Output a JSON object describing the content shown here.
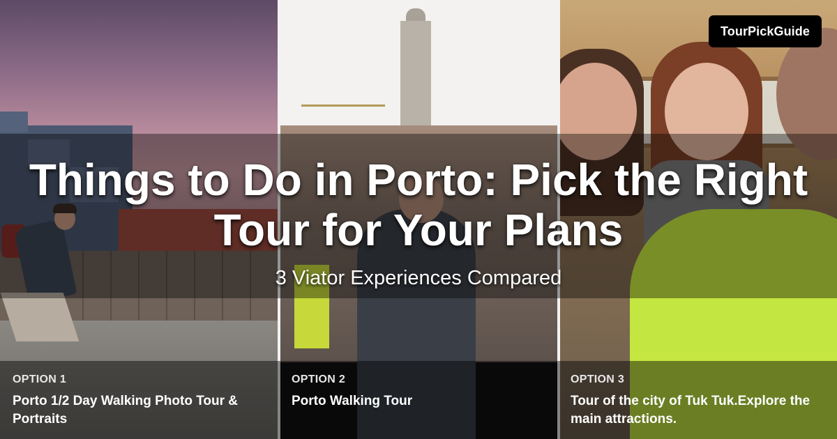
{
  "brand": {
    "name": "TourPickGuide"
  },
  "header": {
    "title": "Things to Do in Porto: Pick the Right Tour for Your Plans",
    "subtitle": "3 Viator Experiences Compared"
  },
  "options": [
    {
      "label": "OPTION 1",
      "title": "Porto 1/2 Day Walking Photo Tour & Portraits"
    },
    {
      "label": "OPTION 2",
      "title": "Porto Walking Tour"
    },
    {
      "label": "OPTION 3",
      "title": "Tour of the city of Tuk Tuk.Explore the main attractions."
    }
  ],
  "colors": {
    "badge_background": "#000000",
    "text": "#ffffff",
    "overlay": "rgba(0,0,0,0.4)"
  }
}
